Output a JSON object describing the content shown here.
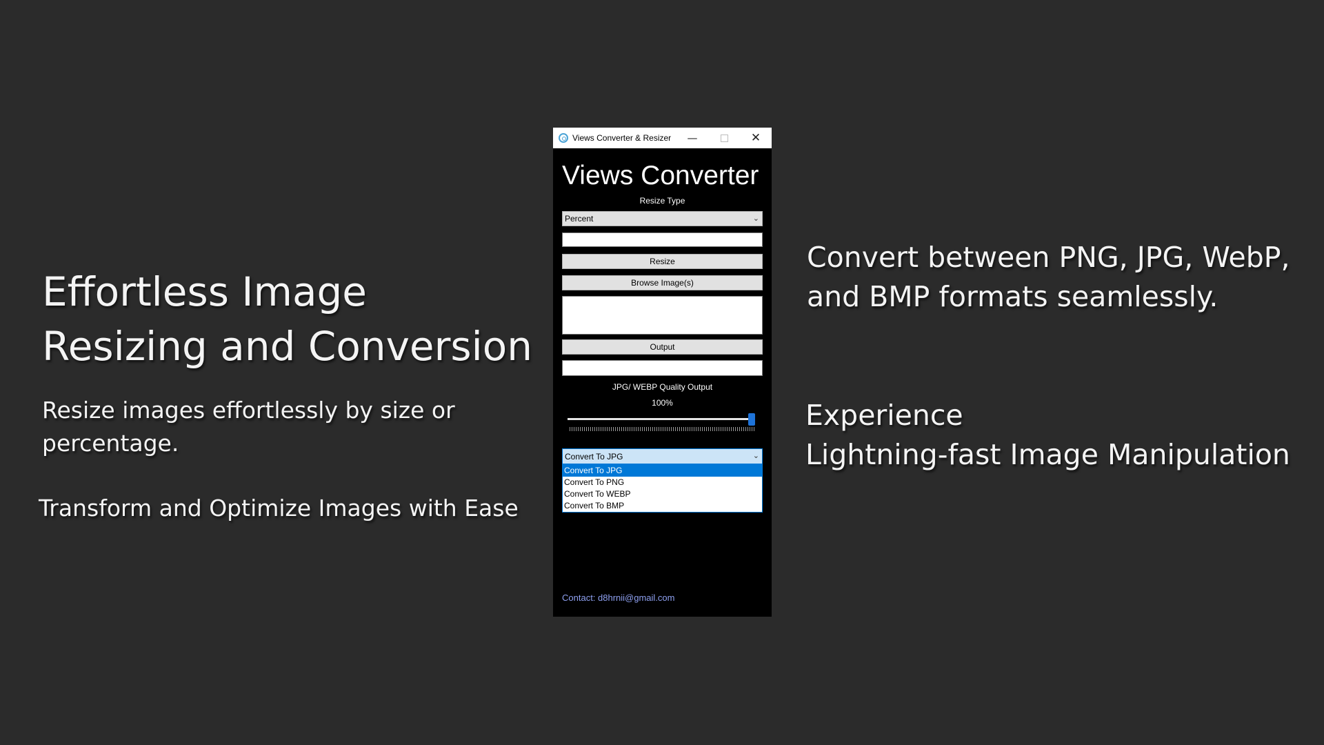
{
  "promo": {
    "headline": "Effortless Image Resizing and Conversion",
    "sub1": "Resize images effortlessly by size or percentage.",
    "sub2": "Transform and Optimize Images with Ease",
    "right1": "Convert between PNG, JPG, WebP, and BMP formats seamlessly.",
    "right2_line1": "Experience",
    "right2_line2": "Lightning-fast Image Manipulation"
  },
  "window": {
    "title": "Views Converter & Resizer",
    "minimize_glyph": "—",
    "close_glyph": "✕",
    "icons": {
      "app": "app-logo-icon",
      "minimize": "minimize-icon",
      "maximize": "maximize-icon",
      "close": "close-icon"
    }
  },
  "app": {
    "heading": "Views Converter",
    "resize_type_label": "Resize Type",
    "resize_type_value": "Percent",
    "resize_value_input": "",
    "resize_button": "Resize",
    "browse_button": "Browse Image(s)",
    "files_box": "",
    "output_button": "Output",
    "output_path": "",
    "quality_label": "JPG/ WEBP Quality Output",
    "quality_value_text": "100%",
    "quality_fraction": 1.0,
    "format_selected": "Convert To JPG",
    "format_options": [
      "Convert To JPG",
      "Convert To PNG",
      "Convert To WEBP",
      "Convert To BMP"
    ],
    "contact": "Contact: d8hrnii@gmail.com"
  },
  "colors": {
    "background": "#2b2b2b",
    "window_body": "#000000",
    "accent": "#0078d7",
    "contact_link": "#8ea0f0"
  }
}
